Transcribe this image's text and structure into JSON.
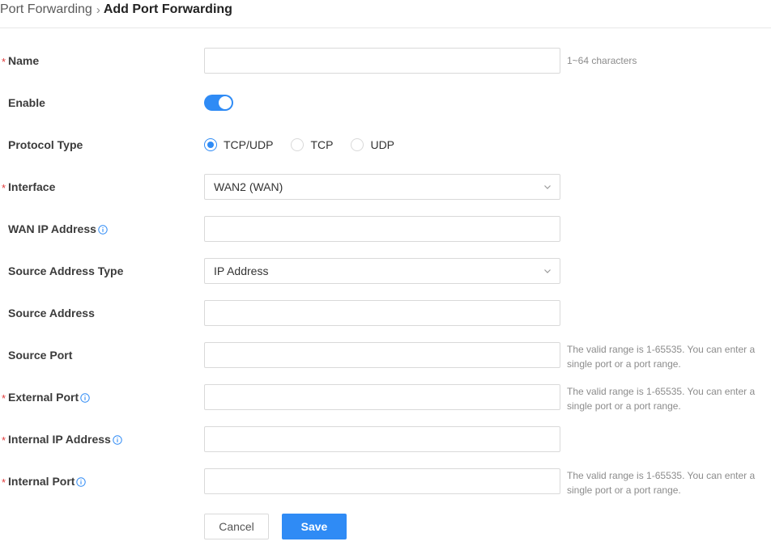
{
  "breadcrumb": {
    "parent": "Port Forwarding",
    "separator": "›",
    "current": "Add Port Forwarding"
  },
  "fields": {
    "name": {
      "label": "Name",
      "required": "*",
      "value": "",
      "hint": "1~64 characters"
    },
    "enable": {
      "label": "Enable",
      "state": "on"
    },
    "protocol": {
      "label": "Protocol Type",
      "options": [
        "TCP/UDP",
        "TCP",
        "UDP"
      ],
      "selected": "TCP/UDP"
    },
    "interface": {
      "label": "Interface",
      "required": "*",
      "value": "WAN2 (WAN)"
    },
    "wan_ip": {
      "label": "WAN IP Address",
      "value": ""
    },
    "source_address_type": {
      "label": "Source Address Type",
      "value": "IP Address"
    },
    "source_address": {
      "label": "Source Address",
      "value": ""
    },
    "source_port": {
      "label": "Source Port",
      "value": "",
      "hint_line1": "The valid range is 1-65535. You can enter a",
      "hint_line2": "single port or a port range."
    },
    "external_port": {
      "label": "External Port",
      "required": "*",
      "value": "",
      "hint_line1": "The valid range is 1-65535. You can enter a",
      "hint_line2": "single port or a port range."
    },
    "internal_ip": {
      "label": "Internal IP Address",
      "required": "*",
      "value": ""
    },
    "internal_port": {
      "label": "Internal Port",
      "required": "*",
      "value": "",
      "hint_line1": "The valid range is 1-65535. You can enter a",
      "hint_line2": "single port or a port range."
    }
  },
  "buttons": {
    "cancel": "Cancel",
    "save": "Save"
  },
  "colors": {
    "accent": "#2f8bf5",
    "required": "#e03a3a",
    "border": "#d9d9d9",
    "hint": "#8c8c8c"
  }
}
